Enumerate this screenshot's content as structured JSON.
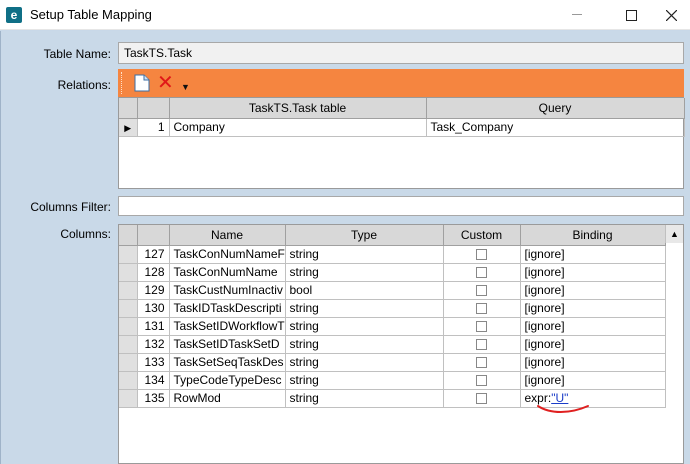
{
  "window": {
    "title": "Setup Table Mapping",
    "app_icon_letter": "e"
  },
  "labels": {
    "table_name": "Table Name:",
    "relations": "Relations:",
    "columns_filter": "Columns Filter:",
    "columns": "Columns:"
  },
  "table_name_value": "TaskTS.Task",
  "columns_filter_value": "",
  "relations": {
    "headers": [
      "TaskTS.Task table",
      "Query"
    ],
    "rows": [
      {
        "num": "1",
        "table": "Company",
        "query": "Task_Company"
      }
    ]
  },
  "columns": {
    "headers": [
      "Name",
      "Type",
      "Custom",
      "Binding"
    ],
    "rows": [
      {
        "num": "127",
        "name": "TaskConNumNameF",
        "type": "string",
        "custom": false,
        "binding": "[ignore]"
      },
      {
        "num": "128",
        "name": "TaskConNumName",
        "type": "string",
        "custom": false,
        "binding": "[ignore]"
      },
      {
        "num": "129",
        "name": "TaskCustNumInactiv",
        "type": "bool",
        "custom": false,
        "binding": "[ignore]"
      },
      {
        "num": "130",
        "name": "TaskIDTaskDescripti",
        "type": "string",
        "custom": false,
        "binding": "[ignore]"
      },
      {
        "num": "131",
        "name": "TaskSetIDWorkflowT",
        "type": "string",
        "custom": false,
        "binding": "[ignore]"
      },
      {
        "num": "132",
        "name": "TaskSetIDTaskSetD",
        "type": "string",
        "custom": false,
        "binding": "[ignore]"
      },
      {
        "num": "133",
        "name": "TaskSetSeqTaskDes",
        "type": "string",
        "custom": false,
        "binding": "[ignore]"
      },
      {
        "num": "134",
        "name": "TypeCodeTypeDesc",
        "type": "string",
        "custom": false,
        "binding": "[ignore]"
      },
      {
        "num": "135",
        "name": "RowMod",
        "type": "string",
        "custom": false,
        "binding_prefix": "expr:",
        "binding_link": "\"U\""
      }
    ]
  },
  "colors": {
    "toolbar": "#f58540",
    "background": "#c9d9e8",
    "annotation": "#e02020"
  }
}
